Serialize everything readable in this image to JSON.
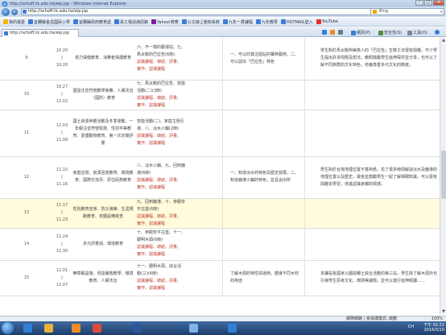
{
  "window": {
    "title": "http://schoff.ilc.edu.tw/eip.jsp - Windows Internet Explorer",
    "controls": [
      "–",
      "□",
      "✕"
    ]
  },
  "address": {
    "url": "http://schoff.ilc.edu.tw/eip.jsp",
    "search_placeholder": "Bing"
  },
  "favorites": [
    {
      "label": "我的最愛",
      "icon": "star-icon",
      "color": "#f2b600"
    },
    {
      "label": "宜蘭縣金岳國民小學",
      "icon": "page-icon",
      "color": "#3b7dd8"
    },
    {
      "label": "宜蘭縣政府教育處",
      "icon": "page-icon",
      "color": "#3b7dd8"
    },
    {
      "label": "員工電話通訊錄",
      "icon": "page-icon",
      "color": "#3b7dd8"
    },
    {
      "label": "Yahoo!奇摩",
      "icon": "yahoo-icon",
      "color": "#7b1fa2"
    },
    {
      "label": "公文線上簽核系統",
      "icon": "page-icon",
      "color": "#3b7dd8"
    },
    {
      "label": "九年一貫課程",
      "icon": "page-icon",
      "color": "#3b7dd8"
    },
    {
      "label": "九年教學",
      "icon": "page-icon",
      "color": "#3b7dd8"
    },
    {
      "label": "HOTMAIL登入",
      "icon": "page-icon",
      "color": "#3b7dd8"
    },
    {
      "label": "YouTube",
      "icon": "youtube-icon",
      "color": "#e52d27"
    }
  ],
  "tab": {
    "label": "http://schoff.ilc.edu.tw/eip.jsp"
  },
  "commands": [
    {
      "label": "網頁(P)",
      "icon": "page-icon"
    },
    {
      "label": "安全性(S)",
      "icon": "shield-icon"
    },
    {
      "label": "工具(O)",
      "icon": "gear-icon"
    }
  ],
  "rows": [
    {
      "week": "9",
      "date": "10.20\n|\n10.26",
      "topic": "視力保健教育、消費者保護教育",
      "lines": [
        "六、不一樣的慶運站、七、",
        "馬太鞍的巴拉告(6節)"
      ],
      "red": [
        "認識課程、總結、評量、",
        "實作、認識課程"
      ],
      "intent": "一、可以欣賞這個站的獨特藝術、二、可以認出「巴拉告」特色",
      "desc": "學生對於馬太鞍阿美族人的「巴拉告」生態工法很有興趣，不少學生提出許多問題及想法，教師鼓勵學生延伸探究並分享，也可以了解不同族群的文化特色，培養尊重多元文化的態度。",
      "highlight": false
    },
    {
      "week": "10",
      "date": "10.27\n|\n11.02",
      "topic": "國語注音符號教學競賽、人權法治（國防）教育",
      "lines": [
        "七、馬太鞍的巴拉告、技能",
        "活動(二)(3節)"
      ],
      "red": [
        "認識課程、總結、評量、",
        "實作、認識課程"
      ],
      "intent": "",
      "desc": "",
      "highlight": false
    },
    {
      "week": "11",
      "date": "11.03\n|\n11.09",
      "topic": "國土資源參觀活動及冬季運動、一年級注音符號檢測、性別平等教育、愛護動物教育、第一次定期評量",
      "lines": [
        "技能活動(二)、家庭主題引",
        "導、八、淡水小鎮(2節)"
      ],
      "red": [
        "認識課程、總結、評量、",
        "實作、認識課程"
      ],
      "intent": "",
      "desc": "",
      "highlight": false
    },
    {
      "week": "12",
      "date": "11.10\n|\n11.16",
      "topic": "家庭訪問、資源回收教育、環境教育、國際交流月、原住民族教育",
      "lines": [
        "八、淡水小鎮、九、回到鹿",
        "港(6節)"
      ],
      "red": [
        "認識課程、總結、評量、",
        "實作、認識課程"
      ],
      "intent": "一、知道淡水的特色及歷史發展。二、知道鹿港小鎮的特色，並且說出所",
      "desc": "學生對於台灣地理位置不甚熟悉，花了很多時間解說淡水及鹿港的地理位置以及歷史，最後並鼓勵學生一起了解相關知識，可以更有興趣去學習，增進認識家鄉的情感。",
      "highlight": false
    },
    {
      "week": "13",
      "date": "11.17\n|\n11.23",
      "topic": "性別教育宣導、防災演練、生涯規劃教育、校園設備檢查",
      "lines": [
        "九、回到鹿港、十、參觀安",
        "平古堡(6節)"
      ],
      "red": [
        "認識課程、總結、評量、",
        "實作、認識課程"
      ],
      "intent": "",
      "desc": "",
      "highlight": true
    },
    {
      "week": "14",
      "date": "11.24\n|\n11.30",
      "topic": "多元評量週、環境教育",
      "lines": [
        "十、參觀安平古堡、十一、",
        "聰明木頭(6節)"
      ],
      "red": [
        "認識課程、總結、評量、",
        "實作、認識課程"
      ],
      "intent": "",
      "desc": "",
      "highlight": false
    },
    {
      "week": "15",
      "date": "12.01\n|\n12.07",
      "topic": "無障礙設施、母語補救教學、環境教育、人權法治",
      "lines": [
        "十一、聰明木頭、綜合活",
        "動(三)(6節)"
      ],
      "red": [
        "認識課程、總結、評量、",
        "實作、認識課程"
      ],
      "intent": "了解木頭的特性與運用，體會不同木材的用途",
      "desc": "本課是各國家公園與鄉土綜合活動的第三站，學生除了解木頭外也引導學生思考文化、環境等議題，並可以進行延伸閱讀……",
      "highlight": false
    }
  ],
  "status": {
    "zone": "網際網路 | 受保護模式: 啟動",
    "zoom": "100%"
  },
  "taskbar": {
    "apps": [
      {
        "name": "ie-icon",
        "color": "#2f7fd6"
      },
      {
        "name": "folder-icon",
        "color": "#e8b23c"
      },
      {
        "name": "media-player-icon",
        "color": "#f08a24"
      },
      {
        "name": "chrome-icon",
        "color": "#dd4b39"
      },
      {
        "name": "word-icon",
        "color": "#2b579a"
      },
      {
        "name": "paint-icon",
        "color": "#7fb3ea"
      },
      {
        "name": "ie-window-icon",
        "color": "#2f7fd6"
      }
    ],
    "lang": "CH",
    "time": "下午 02:22",
    "date": "2014/3/10"
  }
}
